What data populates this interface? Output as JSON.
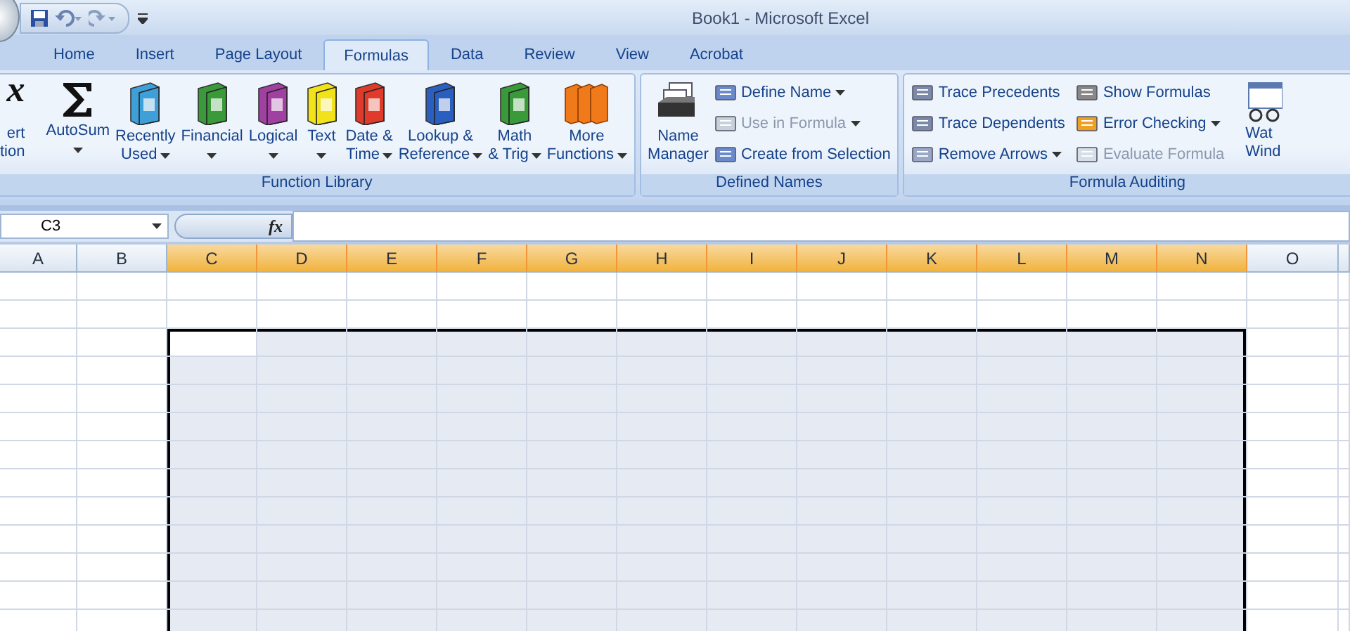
{
  "window": {
    "title": "Book1 - Microsoft Excel"
  },
  "tabs": [
    {
      "label": "Home",
      "selected": false
    },
    {
      "label": "Insert",
      "selected": false
    },
    {
      "label": "Page Layout",
      "selected": false
    },
    {
      "label": "Formulas",
      "selected": true
    },
    {
      "label": "Data",
      "selected": false
    },
    {
      "label": "Review",
      "selected": false
    },
    {
      "label": "View",
      "selected": false
    },
    {
      "label": "Acrobat",
      "selected": false
    }
  ],
  "insert_function": {
    "icon": "x",
    "lines": [
      "ert",
      "tion"
    ]
  },
  "function_library": {
    "label": "Function Library",
    "buttons": [
      {
        "kind": "sum",
        "lines": [
          "AutoSum"
        ],
        "dropdown": true
      },
      {
        "kind": "book",
        "color": "#3f9fd8",
        "lines": [
          "Recently",
          "Used"
        ],
        "dropdown": true
      },
      {
        "kind": "book",
        "color": "#3a9a3a",
        "lines": [
          "Financial"
        ],
        "dropdown": true
      },
      {
        "kind": "book",
        "color": "#a040a0",
        "lines": [
          "Logical"
        ],
        "dropdown": true
      },
      {
        "kind": "book",
        "color": "#f2e21a",
        "lines": [
          "Text"
        ],
        "dropdown": true
      },
      {
        "kind": "book",
        "color": "#e03a2a",
        "lines": [
          "Date &",
          "Time"
        ],
        "dropdown": true
      },
      {
        "kind": "book",
        "color": "#2a5fc0",
        "lines": [
          "Lookup &",
          "Reference"
        ],
        "dropdown": true
      },
      {
        "kind": "book",
        "color": "#3a9a3a",
        "lines": [
          "Math",
          "& Trig"
        ],
        "dropdown": true
      },
      {
        "kind": "books",
        "color": "#f07a1a",
        "lines": [
          "More",
          "Functions"
        ],
        "dropdown": true
      }
    ]
  },
  "defined_names": {
    "label": "Defined Names",
    "manager": [
      "Name",
      "Manager"
    ],
    "items": [
      {
        "label": "Define Name",
        "dropdown": true,
        "disabled": false
      },
      {
        "label": "Use in Formula",
        "dropdown": true,
        "disabled": true
      },
      {
        "label": "Create from Selection",
        "dropdown": false,
        "disabled": false
      }
    ]
  },
  "formula_auditing": {
    "label": "Formula Auditing",
    "items": [
      {
        "label": "Trace Precedents",
        "dropdown": false,
        "disabled": false
      },
      {
        "label": "Trace Dependents",
        "dropdown": false,
        "disabled": false
      },
      {
        "label": "Remove Arrows",
        "dropdown": true,
        "disabled": false
      },
      {
        "label": "Show Formulas",
        "dropdown": false,
        "disabled": false
      },
      {
        "label": "Error Checking",
        "dropdown": true,
        "disabled": false
      },
      {
        "label": "Evaluate Formula",
        "dropdown": false,
        "disabled": true
      }
    ],
    "watch": [
      "Wat",
      "Wind"
    ]
  },
  "name_box": {
    "value": "C3"
  },
  "formula_bar": {
    "fx": "fx"
  },
  "columns": [
    {
      "label": "A",
      "selected": false
    },
    {
      "label": "B",
      "selected": false
    },
    {
      "label": "C",
      "selected": true
    },
    {
      "label": "D",
      "selected": true
    },
    {
      "label": "E",
      "selected": true
    },
    {
      "label": "F",
      "selected": true
    },
    {
      "label": "G",
      "selected": true
    },
    {
      "label": "H",
      "selected": true
    },
    {
      "label": "I",
      "selected": true
    },
    {
      "label": "J",
      "selected": true
    },
    {
      "label": "K",
      "selected": true
    },
    {
      "label": "L",
      "selected": true
    },
    {
      "label": "M",
      "selected": true
    },
    {
      "label": "N",
      "selected": true
    },
    {
      "label": "O",
      "selected": false
    }
  ],
  "rows": [
    {
      "selected": false
    },
    {
      "selected": false
    },
    {
      "selected": true
    },
    {
      "selected": true
    },
    {
      "selected": true
    },
    {
      "selected": true
    },
    {
      "selected": true
    },
    {
      "selected": true
    },
    {
      "selected": true
    },
    {
      "selected": true
    },
    {
      "selected": true
    },
    {
      "selected": true
    },
    {
      "selected": true
    }
  ]
}
